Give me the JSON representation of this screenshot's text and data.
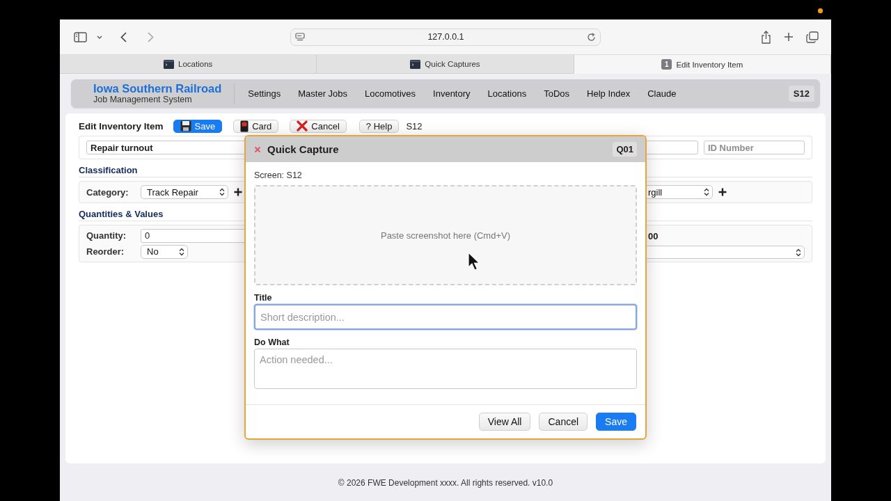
{
  "browser": {
    "address": "127.0.0.1",
    "tabs": [
      {
        "label": "Locations",
        "selected": false
      },
      {
        "label": "Quick Captures",
        "selected": false
      },
      {
        "label": "Edit Inventory Item",
        "badge": "1",
        "selected": true
      }
    ]
  },
  "app_header": {
    "title": "Iowa Southern Railroad",
    "subtitle": "Job Management System",
    "nav": [
      "Settings",
      "Master Jobs",
      "Locomotives",
      "Inventory",
      "Locations",
      "ToDos",
      "Help Index",
      "Claude"
    ],
    "screen_code": "S12"
  },
  "toolbar": {
    "title": "Edit Inventory Item",
    "buttons": [
      {
        "label": "Save",
        "kind": "save"
      },
      {
        "label": "Card",
        "kind": "card"
      },
      {
        "label": "Cancel",
        "kind": "cancel"
      },
      {
        "label": "? Help",
        "kind": "help"
      }
    ],
    "screen_code": "S12"
  },
  "form": {
    "name_field": {
      "value": "Repair turnout"
    },
    "id_field": {
      "placeholder": "ID Number"
    },
    "classification": {
      "heading": "Classification",
      "category_label": "Category:",
      "category_value": "Track Repair",
      "right_select_value": "rgill"
    },
    "quantities": {
      "heading": "Quantities & Values",
      "quantity_label": "Quantity:",
      "quantity_value": "0",
      "reorder_label": "Reorder:",
      "reorder_value": "No",
      "right_value": "00"
    }
  },
  "dialog": {
    "title": "Quick Capture",
    "code": "Q01",
    "screen_label": "Screen: S12",
    "drop_hint": "Paste screenshot here (Cmd+V)",
    "fields": [
      {
        "label": "Title",
        "placeholder": "Short description...",
        "kind": "input",
        "focused": true
      },
      {
        "label": "Do What",
        "placeholder": "Action needed...",
        "kind": "textarea",
        "focused": false
      }
    ],
    "buttons": [
      {
        "label": "View All",
        "kind": "default"
      },
      {
        "label": "Cancel",
        "kind": "default"
      },
      {
        "label": "Save",
        "kind": "primary"
      }
    ]
  },
  "footer": "© 2026 FWE Development xxxx. All rights reserved. v10.0"
}
